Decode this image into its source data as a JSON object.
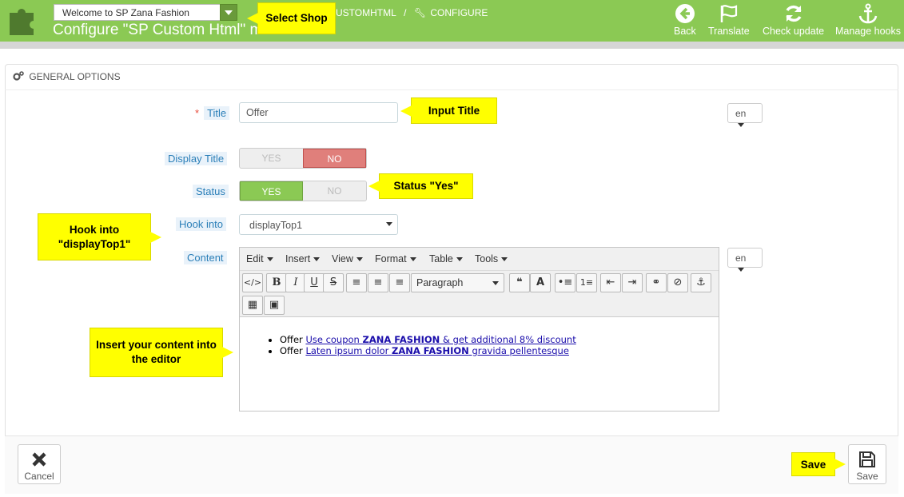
{
  "header": {
    "shop_select": "Welcome to SP Zana Fashion",
    "title": "Configure \"SP Custom Html\" module",
    "breadcrumb": [
      "USTOMHTML",
      "/",
      "CONFIGURE"
    ],
    "toolbar": [
      {
        "label": "Back",
        "icon": "back-circle-icon"
      },
      {
        "label": "Translate",
        "icon": "flag-icon"
      },
      {
        "label": "Check update",
        "icon": "refresh-icon"
      },
      {
        "label": "Manage hooks",
        "icon": "anchor-icon"
      }
    ]
  },
  "callouts": {
    "select_shop": "Select Shop",
    "input_title": "Input Title",
    "status_yes": "Status \"Yes\"",
    "hook_line1": "Hook into",
    "hook_line2": "\"displayTop1\"",
    "content_line1": "Insert your content into",
    "content_line2": "the editor",
    "save": "Save"
  },
  "panel": {
    "heading": "GENERAL OPTIONS",
    "title_label": "Title",
    "title_value": "Offer",
    "lang": "en",
    "display_title_label": "Display Title",
    "status_label": "Status",
    "yes": "YES",
    "no": "NO",
    "display_title_value": "NO",
    "status_value": "YES",
    "hook_label": "Hook into",
    "hook_value": "displayTop1",
    "content_label": "Content"
  },
  "editor": {
    "menu": [
      "Edit",
      "Insert",
      "View",
      "Format",
      "Table",
      "Tools"
    ],
    "paragraph": "Paragraph",
    "items": [
      {
        "prefix": "Offer",
        "pre": "Use coupon ",
        "bold": "ZANA FASHION",
        "post": " & get additional 8% discount"
      },
      {
        "prefix": "Offer",
        "pre": "Laten ipsum dolor ",
        "bold": "ZANA FASHION",
        "post": " gravida pellentesque"
      }
    ]
  },
  "footer": {
    "cancel": "Cancel",
    "save": "Save"
  }
}
